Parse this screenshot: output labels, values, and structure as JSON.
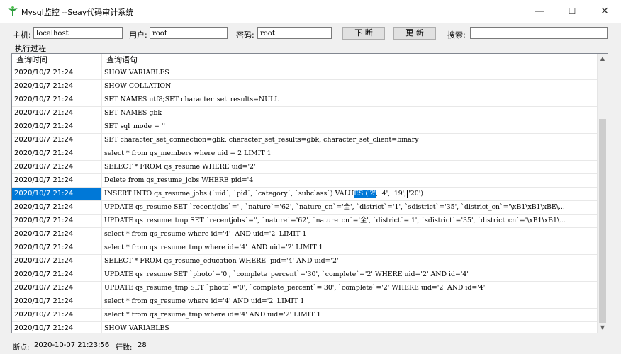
{
  "window": {
    "title": "Mysql监控 --Seay代码审计系统",
    "minimize": "—",
    "maximize": "☐",
    "close": "✕"
  },
  "toolbar": {
    "host_label": "主机:",
    "host_value": "localhost",
    "user_label": "用户:",
    "user_value": "root",
    "password_label": "密码:",
    "password_value": "root",
    "break_button": "下 断",
    "refresh_button": "更 新",
    "search_label": "搜索:",
    "search_value": ""
  },
  "section_label": "执行过程",
  "table": {
    "columns": [
      "查询时间",
      "查询语句"
    ],
    "rows": [
      {
        "time": "2020/10/7 21:24",
        "sql": "SHOW VARIABLES"
      },
      {
        "time": "2020/10/7 21:24",
        "sql": "SHOW COLLATION"
      },
      {
        "time": "2020/10/7 21:24",
        "sql": "SET NAMES utf8;SET character_set_results=NULL"
      },
      {
        "time": "2020/10/7 21:24",
        "sql": "SET NAMES gbk"
      },
      {
        "time": "2020/10/7 21:24",
        "sql": "SET sql_mode = ''"
      },
      {
        "time": "2020/10/7 21:24",
        "sql": "SET character_set_connection=gbk, character_set_results=gbk, character_set_client=binary"
      },
      {
        "time": "2020/10/7 21:24",
        "sql": "select * from qs_members where uid = 2 LIMIT 1"
      },
      {
        "time": "2020/10/7 21:24",
        "sql": "SELECT * FROM qs_resume WHERE uid='2'"
      },
      {
        "time": "2020/10/7 21:24",
        "sql": "Delete from qs_resume_jobs WHERE pid='4'"
      },
      {
        "time": "2020/10/7 21:24",
        "sql": "INSERT INTO qs_resume_jobs (`uid`, `pid`, `category`, `subclass`) VALUES ('2', '4', '19', '20')",
        "selected": true,
        "sql_before": "INSERT INTO qs_resume_jobs (`uid`, `pid`, `category`, `subclass`) VALU",
        "sql_highlight": "ES ('2'",
        "sql_after_a": ", '4', '19',",
        "sql_after_b": "'20')"
      },
      {
        "time": "2020/10/7 21:24",
        "sql": "UPDATE qs_resume SET `recentjobs`='', `nature`='62', `nature_cn`='全', `district`='1', `sdistrict`='35', `district_cn`='\\xB1\\xB1\\xBE\\..."
      },
      {
        "time": "2020/10/7 21:24",
        "sql": "UPDATE qs_resume_tmp SET `recentjobs`='', `nature`='62', `nature_cn`='全', `district`='1', `sdistrict`='35', `district_cn`='\\xB1\\xB1\\..."
      },
      {
        "time": "2020/10/7 21:24",
        "sql": "select * from qs_resume where id='4'  AND uid='2' LIMIT 1"
      },
      {
        "time": "2020/10/7 21:24",
        "sql": "select * from qs_resume_tmp where id='4'  AND uid='2' LIMIT 1"
      },
      {
        "time": "2020/10/7 21:24",
        "sql": "SELECT * FROM qs_resume_education WHERE  pid='4' AND uid='2'"
      },
      {
        "time": "2020/10/7 21:24",
        "sql": "UPDATE qs_resume SET `photo`='0', `complete_percent`='30', `complete`='2' WHERE uid='2' AND id='4'"
      },
      {
        "time": "2020/10/7 21:24",
        "sql": "UPDATE qs_resume_tmp SET `photo`='0', `complete_percent`='30', `complete`='2' WHERE uid='2' AND id='4'"
      },
      {
        "time": "2020/10/7 21:24",
        "sql": "select * from qs_resume where id='4' AND uid='2' LIMIT 1"
      },
      {
        "time": "2020/10/7 21:24",
        "sql": "select * from qs_resume_tmp where id='4' AND uid='2' LIMIT 1"
      },
      {
        "time": "2020/10/7 21:24",
        "sql": "SHOW VARIABLES"
      }
    ]
  },
  "status": {
    "breakpoint_label": "断点:",
    "breakpoint_value": "2020-10-07 21:23:56",
    "rows_label": "行数:",
    "rows_value": "28"
  },
  "colors": {
    "selection": "#0078d7",
    "icon_green": "#2e9e3e"
  }
}
